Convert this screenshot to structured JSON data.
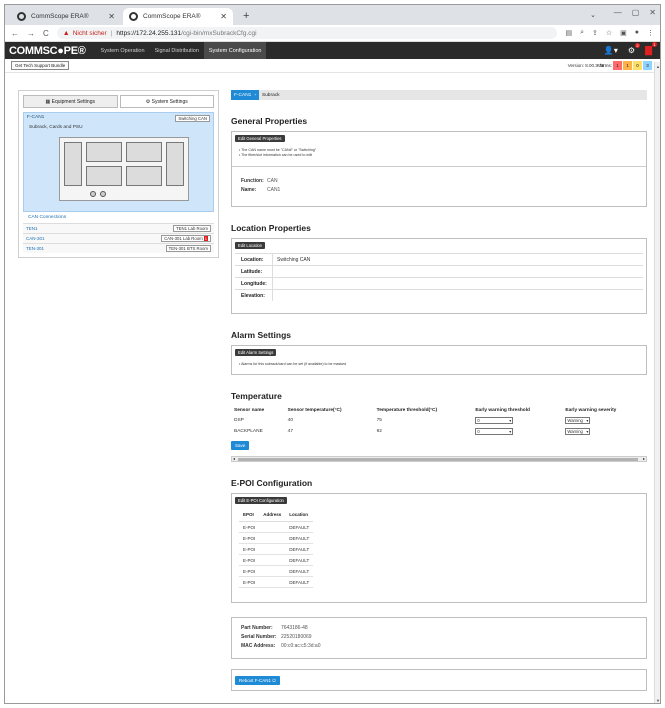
{
  "browser": {
    "tabs": [
      {
        "title": "CommScope ERA®",
        "active": false
      },
      {
        "title": "CommScope ERA®",
        "active": true
      }
    ],
    "new_tab": "+",
    "not_secure": "Nicht sicher",
    "url_host": "https://172.24.255.131",
    "url_path": "/cgi-bin/mxSubrackCfg.cgi"
  },
  "app": {
    "logo": "COMMSC●PE®",
    "nav": [
      "System Operation",
      "Signal Distribution",
      "System Configuration"
    ],
    "active_nav": 2,
    "header_badges": {
      "gear": "2",
      "ctrl": "1"
    },
    "support_button": "Get Tech Support Bundle",
    "version": "Version: 8.00.3.78",
    "alarms_label": "Alarms:",
    "alarm_counts": [
      "1",
      "1",
      "0",
      "3"
    ]
  },
  "left_panel": {
    "tabs": [
      "Equipment Settings",
      "System Settings"
    ],
    "device_name": "F-CAN1",
    "device_button": "Switching CAN",
    "device_sub": "Subrack, Cards and PSU",
    "can_connections": "CAN Connections",
    "rows": [
      {
        "name": "TEN1",
        "button": "TEN1 Lab Room",
        "alarm": ""
      },
      {
        "name": "CAN-301",
        "button": "CAN-301 Lab Room",
        "alarm": "1"
      },
      {
        "name": "TEN-301",
        "button": "TEN-301 BTS Room",
        "alarm": ""
      }
    ]
  },
  "breadcrumb": {
    "items": [
      "F-CAN1",
      "Subrack"
    ]
  },
  "general": {
    "title": "General Properties",
    "edit_button": "Edit General Properties",
    "notes": [
      "The CAN name must be \"CAN#\" or \"Switching\"",
      "The fiber/slot information can be used to edit"
    ],
    "function_label": "Function:",
    "function_value": "CAN",
    "name_label": "Name:",
    "name_value": "CAN1"
  },
  "location": {
    "title": "Location Properties",
    "edit_button": "Edit Location",
    "rows": [
      {
        "k": "Location:",
        "v": "Switching CAN"
      },
      {
        "k": "Latitude:",
        "v": ""
      },
      {
        "k": "Longitude:",
        "v": ""
      },
      {
        "k": "Elevation:",
        "v": ""
      }
    ]
  },
  "alarm_settings": {
    "title": "Alarm Settings",
    "edit_button": "Edit Alarm Settings",
    "note": "Alarms for this subrack/card can be set (if available) to be masked"
  },
  "temperature": {
    "title": "Temperature",
    "headers": [
      "Sensor name",
      "Sensor temperature(°C)",
      "Temperature threshold(°C)",
      "Early warning threshold",
      "Early warning severity"
    ],
    "rows": [
      {
        "name": "DSP",
        "temp": "40",
        "threshold": "75",
        "early": "0",
        "severity": "Warning"
      },
      {
        "name": "BACKPLANE",
        "temp": "47",
        "threshold": "92",
        "early": "0",
        "severity": "Warning"
      }
    ],
    "save": "Save"
  },
  "epoi": {
    "title": "E-POI Configuration",
    "edit_button": "Edit E-POI Configuration",
    "headers": [
      "EPOI",
      "Address",
      "Location"
    ],
    "rows": [
      {
        "epoi": "E-POI",
        "address": "",
        "location": "DEFAULT"
      },
      {
        "epoi": "E-POI",
        "address": "",
        "location": "DEFAULT"
      },
      {
        "epoi": "E-POI",
        "address": "",
        "location": "DEFAULT"
      },
      {
        "epoi": "E-POI",
        "address": "",
        "location": "DEFAULT"
      },
      {
        "epoi": "E-POI",
        "address": "",
        "location": "DEFAULT"
      },
      {
        "epoi": "E-POI",
        "address": "",
        "location": "DEFAULT"
      }
    ]
  },
  "device_info": {
    "rows": [
      {
        "k": "Part Number:",
        "v": "7643186-48"
      },
      {
        "k": "Serial Number:",
        "v": "22520180069"
      },
      {
        "k": "MAC Address:",
        "v": "00:c0:ac:c5:3d:a0"
      }
    ]
  },
  "reboot_button": "Reboot F-CAN1"
}
